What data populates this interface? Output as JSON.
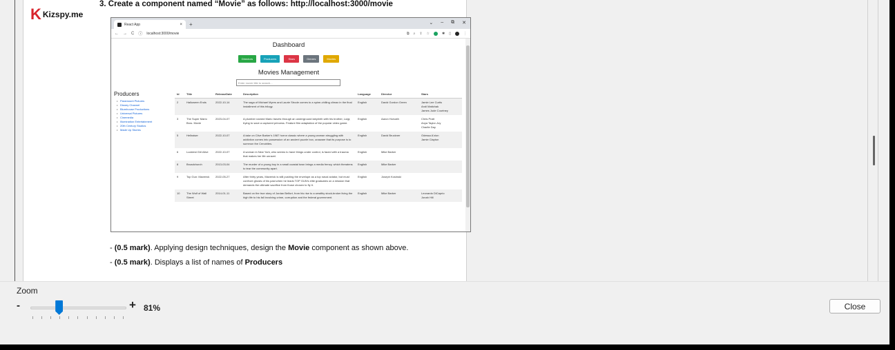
{
  "logo": {
    "mark": "K",
    "text": "Kizspy.me"
  },
  "heading": "3. Create a component named “Movie” as follows: http://localhost:3000/movie",
  "browser": {
    "tab_title": "React App",
    "tab_close": "×",
    "new_tab": "+",
    "window_controls": [
      "⌄",
      "–",
      "⧉",
      "✕"
    ],
    "url": "localhost:3000/movie",
    "nav_icons": [
      "←",
      "→",
      "C",
      "ⓘ"
    ]
  },
  "app": {
    "dashboard_title": "Dashboard",
    "nav_buttons": [
      {
        "label": "Directors",
        "color": "#28a745"
      },
      {
        "label": "Producers",
        "color": "#17a2b8"
      },
      {
        "label": "Stars",
        "color": "#dc3545"
      },
      {
        "label": "Genres",
        "color": "#6c757d"
      },
      {
        "label": "Movies",
        "color": "#e0a800"
      }
    ],
    "movies_title": "Movies Management",
    "search_placeholder": "Enter movie title to search...",
    "producers_heading": "Producers",
    "producers": [
      "Paramount Pictures",
      "Disney Channel",
      "Blumhouse Productions",
      "Universal Pictures",
      "Cinemedia",
      "Illumination Entertainment",
      "20th Century Studios",
      "Made Up Stories"
    ],
    "columns": [
      "Id",
      "Title",
      "ReleaseDate",
      "Description",
      "Language",
      "Director",
      "Stars"
    ],
    "rows": [
      {
        "id": "2",
        "title": "Halloween Ends",
        "date": "2022-10-14",
        "desc": "The saga of Michael Myers and Laurie Strode comes to a spine-chilling climax in the final installment of this trilogy.",
        "lang": "English",
        "director": "David Gordon Green",
        "stars": [
          "Jamie Lee Curtis",
          "Andi Matichak",
          "James Jude Courtney"
        ]
      },
      {
        "id": "3",
        "title": "The Super Mario Bros. Movie",
        "date": "2023-04-07",
        "desc": "A plumber named Mario travels through an underground labyrinth with his brother, Luigi, trying to save a captured princess. Feature film adaptation of the popular video game.",
        "lang": "English",
        "director": "Aaron Horvath",
        "stars": [
          "Chris Pratt",
          "Anya Taylor-Joy",
          "Charlie Day"
        ]
      },
      {
        "id": "5",
        "title": "Hellraiser",
        "date": "2022-10-07",
        "desc": "A take on Clive Barker's 1987 horror classic where a young woman struggling with addiction comes into possession of an ancient puzzle box, unaware that its purpose is to summon the Cenobites.",
        "lang": "English",
        "director": "David Bruckner",
        "stars": [
          "Odessa A'zion",
          "Jamie Clayton"
        ]
      },
      {
        "id": "6",
        "title": "Luckiest Girl Alive",
        "date": "2022-10-07",
        "desc": "A woman in New York, who seems to have things under control, is faced with a trauma that makes her life unravel.",
        "lang": "English",
        "director": "Mike Barker",
        "stars": []
      },
      {
        "id": "8",
        "title": "Broadchurch",
        "date": "2013-03-04",
        "desc": "The murder of a young boy in a small coastal town brings a media frenzy, which threatens to tear the community apart.",
        "lang": "English",
        "director": "Mike Barker",
        "stars": []
      },
      {
        "id": "9",
        "title": "Top Gun: Maverick",
        "date": "2022-05-27",
        "desc": "After thirty years, Maverick is still pushing the envelope as a top naval aviator, but must confront ghosts of his past when he leads TOP GUN's elite graduates on a mission that demands the ultimate sacrifice from those chosen to fly it.",
        "lang": "English",
        "director": "Joseph Kosinski",
        "stars": []
      },
      {
        "id": "10",
        "title": "The Wolf of Wall Street",
        "date": "2014-01-11",
        "desc": "Based on the true story of Jordan Belfort, from his rise to a wealthy stock-broker living the high life to his fall involving crime, corruption and the federal government.",
        "lang": "English",
        "director": "Mike Barker",
        "stars": [
          "Leonardo DiCaprio",
          "Jonah Hill"
        ]
      }
    ]
  },
  "instructions": {
    "p1": {
      "prefix": "- ",
      "mark": "(0.5 mark)",
      "middle": ". Applying design techniques, design the ",
      "bold": "Movie",
      "suffix": " component as shown above."
    },
    "p2": {
      "prefix": "- ",
      "mark": "(0.5 mark)",
      "middle": ". Displays a list of names of ",
      "bold": "Producers",
      "suffix": ""
    }
  },
  "zoom": {
    "label": "Zoom",
    "minus": "-",
    "plus": "+",
    "value": "81%",
    "level_fraction": 0.3
  },
  "close_label": "Close",
  "colors": {
    "accent": "#0078d7",
    "logo_red": "#d8242c",
    "link": "#0b5ed7"
  }
}
